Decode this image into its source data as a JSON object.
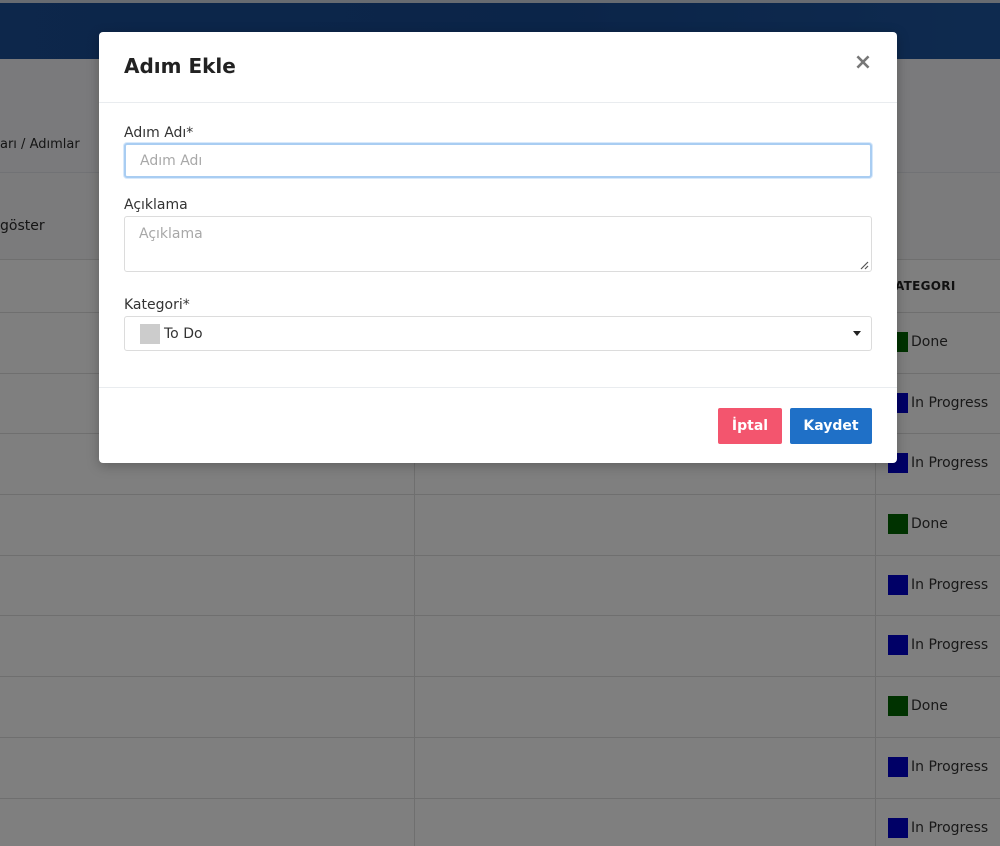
{
  "background": {
    "breadcrumb": "arı / Adımlar",
    "show_label": "göster",
    "table": {
      "category_header": "ATEGORI",
      "rows": [
        {
          "category": "Done",
          "color": "#006400"
        },
        {
          "category": "In Progress",
          "color": "#0000cc"
        },
        {
          "category": "In Progress",
          "color": "#0000cc"
        },
        {
          "category": "Done",
          "color": "#006400"
        },
        {
          "category": "In Progress",
          "color": "#0000cc"
        },
        {
          "category": "In Progress",
          "color": "#0000cc"
        },
        {
          "category": "Done",
          "color": "#006400"
        },
        {
          "category": "In Progress",
          "color": "#0000cc"
        },
        {
          "category": "In Progress",
          "color": "#0000cc"
        }
      ]
    }
  },
  "modal": {
    "title": "Adım Ekle",
    "close_icon": "close-icon",
    "step_name": {
      "label": "Adım Adı*",
      "placeholder": "Adım Adı",
      "value": ""
    },
    "description": {
      "label": "Açıklama",
      "placeholder": "Açıklama",
      "value": ""
    },
    "category": {
      "label": "Kategori*",
      "selected": "To Do",
      "swatch_color": "#cccccc"
    },
    "buttons": {
      "cancel": "İptal",
      "save": "Kaydet"
    }
  },
  "colors": {
    "cancel": "#f3556e",
    "save": "#1f70c7",
    "header": "#174a92"
  }
}
